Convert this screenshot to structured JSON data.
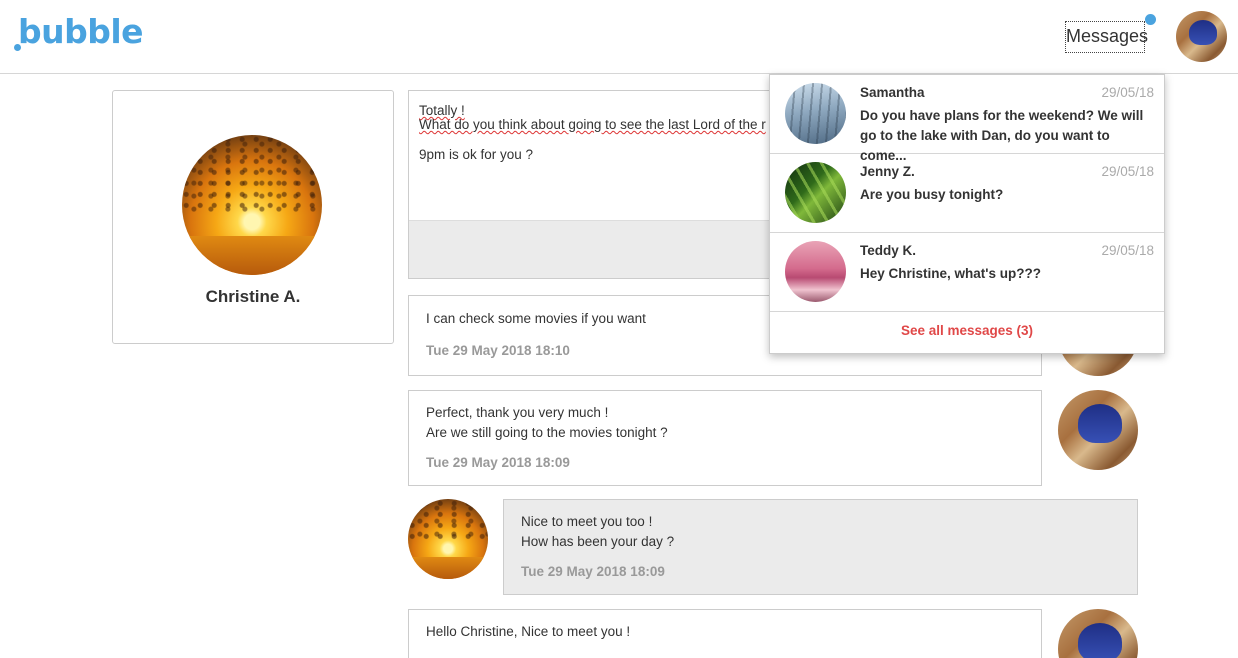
{
  "header": {
    "logo_text": "bubble",
    "messages_label": "Messages"
  },
  "profile": {
    "name": "Christine A."
  },
  "conversation": [
    {
      "lines": [
        "Totally !",
        "What do you think about going to see the last Lord of the r",
        "9pm is ok for you ?"
      ]
    },
    {
      "lines": [
        "I can check some movies if you want"
      ],
      "time": "Tue 29 May 2018 18:10"
    },
    {
      "lines": [
        "Perfect, thank you very much !",
        "Are we still going to the movies tonight ?"
      ],
      "time": "Tue 29 May 2018 18:09"
    },
    {
      "lines": [
        "Nice to meet you too !",
        "How has been your day ?"
      ],
      "time": "Tue 29 May 2018 18:09"
    },
    {
      "lines": [
        "Hello Christine, Nice to meet you !"
      ]
    }
  ],
  "dropdown": {
    "items": [
      {
        "name": "Samantha",
        "date": "29/05/18",
        "text": "Do you have plans for the weekend? We will go to the lake with Dan, do you want to come..."
      },
      {
        "name": "Jenny Z.",
        "date": "29/05/18",
        "text": "Are you busy tonight?"
      },
      {
        "name": "Teddy K.",
        "date": "29/05/18",
        "text": "Hey Christine, what's up???"
      }
    ],
    "see_all": "See all messages (3)"
  },
  "colors": {
    "brand": "#4aa3df",
    "see_all": "#e04848",
    "gray_bubble": "#ebebeb"
  }
}
